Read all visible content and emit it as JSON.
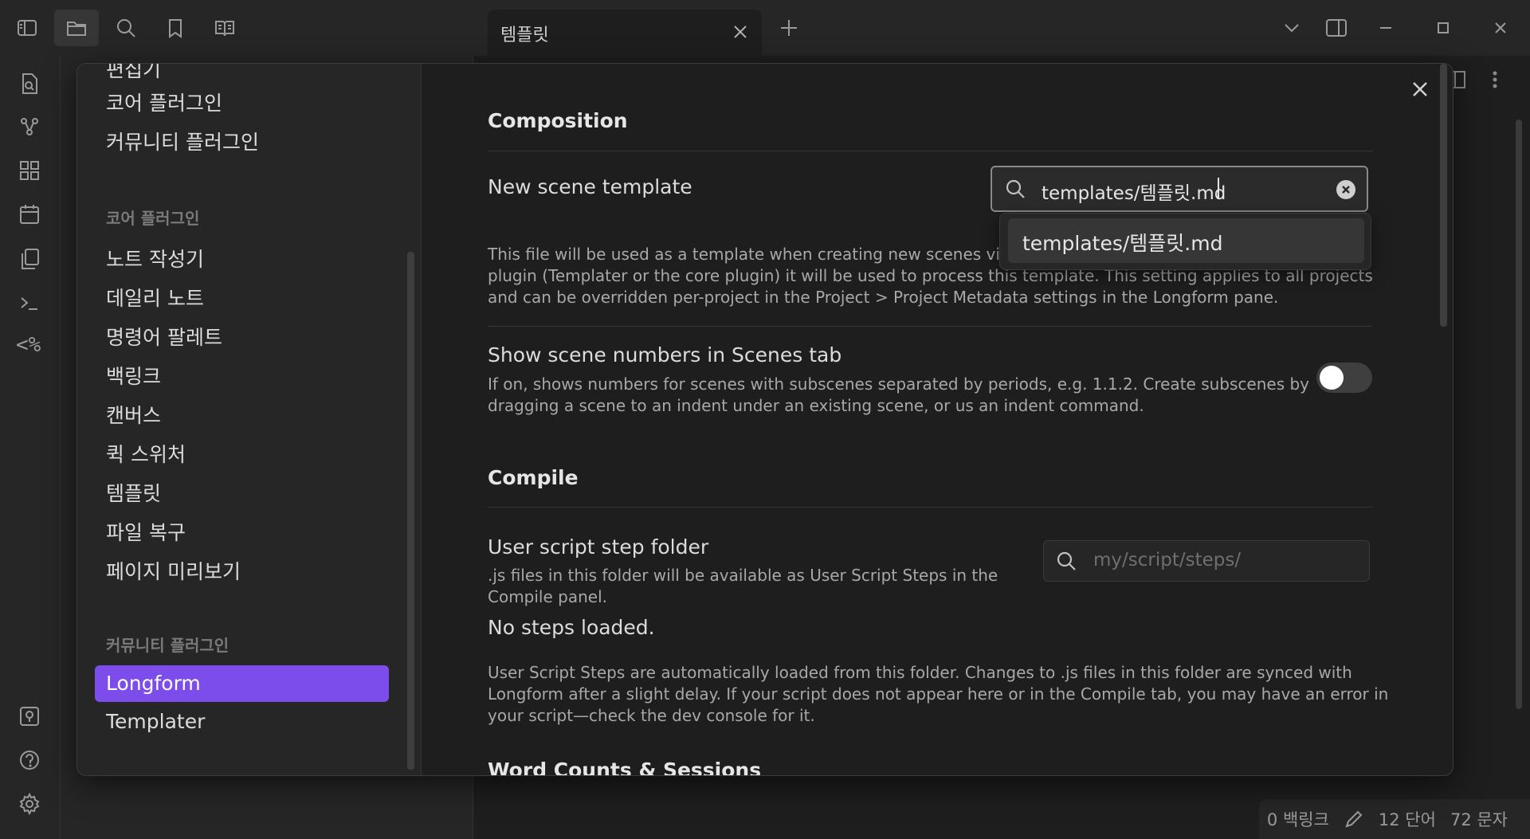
{
  "tab": {
    "title": "템플릿"
  },
  "ribbon_icons": [
    "file-search-icon",
    "graph-icon",
    "blocks-icon",
    "calendar-icon",
    "copy-icon",
    "terminal-icon",
    "templater-icon",
    "vault-icon",
    "help-icon",
    "settings-icon"
  ],
  "templater_glyph": "<%",
  "status": {
    "backlinks": "0 백링크",
    "words": "12 단어",
    "chars": "72 문자"
  },
  "settings_nav": {
    "partial_top": "편집기",
    "top_items": [
      "코어 플러그인",
      "커뮤니티 플러그인"
    ],
    "core_group_label": "코어 플러그인",
    "core_items": [
      "노트 작성기",
      "데일리 노트",
      "명령어 팔레트",
      "백링크",
      "캔버스",
      "퀵 스위처",
      "템플릿",
      "파일 복구",
      "페이지 미리보기"
    ],
    "community_group_label": "커뮤니티 플러그인",
    "community_items": [
      "Longform",
      "Templater"
    ],
    "active_item": "Longform"
  },
  "content": {
    "composition": {
      "heading": "Composition",
      "new_scene_template": {
        "name": "New scene template",
        "value": "templates/템플릿.md",
        "desc_line1": "This file will be used as a template when creating new scenes via",
        "desc_line2": "plugin (Templater or the core plugin) it will be used to process this template. This setting applies to all projects",
        "desc_line3": "and can be overridden per-project in the Project > Project Metadata settings in the Longform pane."
      },
      "suggestion": "templates/템플릿.md",
      "show_scene_numbers": {
        "name": "Show scene numbers in Scenes tab",
        "desc_line1": "If on, shows numbers for scenes with subscenes separated by periods, e.g. 1.1.2. Create subscenes by",
        "desc_line2": "dragging a scene to an indent under an existing scene, or us an indent command.",
        "enabled": false
      }
    },
    "compile": {
      "heading": "Compile",
      "user_script_folder": {
        "name": "User script step folder",
        "desc_line1": ".js files in this folder will be available as User Script Steps in the",
        "desc_line2": "Compile panel.",
        "placeholder": "my/script/steps/"
      },
      "no_steps": "No steps loaded.",
      "steps_desc_line1": "User Script Steps are automatically loaded from this folder. Changes to .js files in this folder are synced with",
      "steps_desc_line2": "Longform after a slight delay. If your script does not appear here or in the Compile tab, you may have an error in",
      "steps_desc_line3": "your script—check the dev console for it."
    },
    "word_counts_heading": "Word Counts & Sessions"
  }
}
